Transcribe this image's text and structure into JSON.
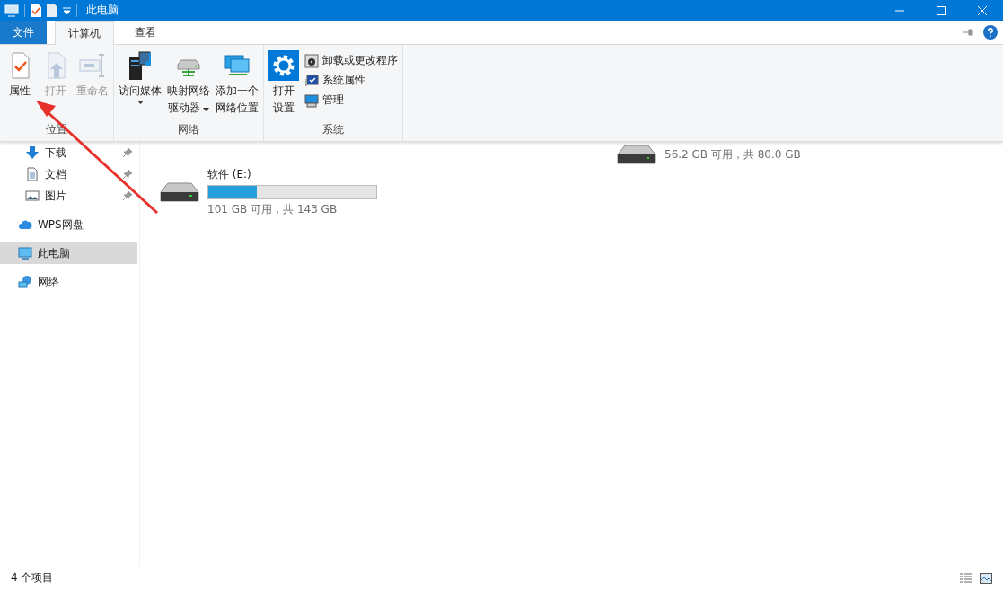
{
  "window": {
    "title": "此电脑"
  },
  "ribbon_tabs": [
    {
      "label": "文件",
      "kind": "file",
      "selected": false
    },
    {
      "label": "计算机",
      "kind": "tab",
      "selected": true
    },
    {
      "label": "查看",
      "kind": "tab",
      "selected": false
    }
  ],
  "ribbon_groups": [
    {
      "label": "位置",
      "large_buttons": [
        {
          "lines": [
            "属性"
          ],
          "kind": "properties",
          "disabled": false,
          "dropdown": false
        },
        {
          "lines": [
            "打开"
          ],
          "kind": "open",
          "disabled": true,
          "dropdown": false
        },
        {
          "lines": [
            "重命名"
          ],
          "kind": "rename",
          "disabled": true,
          "dropdown": false
        }
      ]
    },
    {
      "label": "网络",
      "large_buttons": [
        {
          "lines": [
            "访问媒体"
          ],
          "kind": "media",
          "disabled": false,
          "dropdown": true
        },
        {
          "lines": [
            "映射网络",
            "驱动器"
          ],
          "kind": "mapdrive",
          "disabled": false,
          "dropdown": true
        },
        {
          "lines": [
            "添加一个",
            "网络位置"
          ],
          "kind": "netloc",
          "disabled": false,
          "dropdown": false
        }
      ]
    },
    {
      "label": "系统",
      "large_buttons": [
        {
          "lines": [
            "打开",
            "设置"
          ],
          "kind": "settings",
          "disabled": false,
          "dropdown": false
        }
      ],
      "small_buttons": [
        {
          "label": "卸载或更改程序",
          "kind": "uninstall"
        },
        {
          "label": "系统属性",
          "kind": "sysprops"
        },
        {
          "label": "管理",
          "kind": "manage"
        }
      ]
    }
  ],
  "nav": [
    {
      "label": "下载",
      "kind": "download",
      "pinned": true,
      "selected": false
    },
    {
      "label": "文档",
      "kind": "document",
      "pinned": true,
      "selected": false
    },
    {
      "label": "图片",
      "kind": "image",
      "pinned": true,
      "selected": false
    },
    {
      "label": "WPS网盘",
      "kind": "cloud",
      "pinned": false,
      "selected": false
    },
    {
      "label": "此电脑",
      "kind": "pc",
      "pinned": false,
      "selected": true
    },
    {
      "label": "网络",
      "kind": "network",
      "pinned": false,
      "selected": false
    }
  ],
  "drives": [
    {
      "free": "56.2 GB 可用，共 80.0 GB"
    },
    {
      "name": "软件 (E:)",
      "level": 0.29,
      "free": "101 GB 可用，共 143 GB"
    }
  ],
  "status_bar": {
    "items": "4 个项目"
  }
}
